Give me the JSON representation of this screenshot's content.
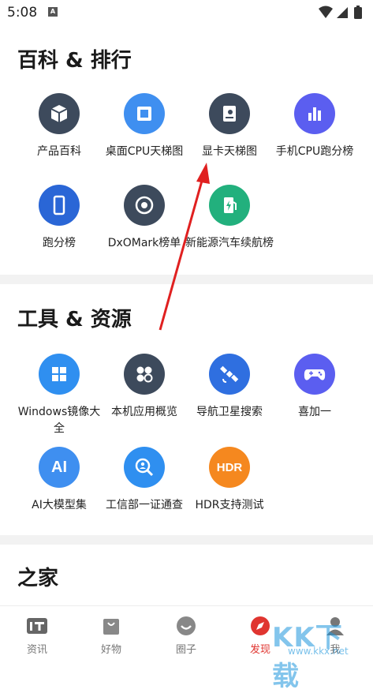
{
  "status_bar": {
    "time": "5:08",
    "notif_glyph": "A"
  },
  "sections": [
    {
      "title": "百科 & 排行",
      "items": [
        {
          "label": "产品百科",
          "icon": "cube-icon",
          "color": "#3d4a5c"
        },
        {
          "label": "桌面CPU天梯图",
          "icon": "cpu-chip-icon",
          "color": "#3f8ff0"
        },
        {
          "label": "显卡天梯图",
          "icon": "graphics-card-icon",
          "color": "#3d4a5c"
        },
        {
          "label": "手机CPU跑分榜",
          "icon": "bar-chart-icon",
          "color": "#5b5ef0"
        },
        {
          "label": "跑分榜",
          "icon": "phone-icon",
          "color": "#2a66d6"
        },
        {
          "label": "DxOMark榜单",
          "icon": "camera-lens-icon",
          "color": "#3d4a5c"
        },
        {
          "label": "新能源汽车续航榜",
          "icon": "charging-station-icon",
          "color": "#22b07d"
        }
      ]
    },
    {
      "title": "工具 & 资源",
      "items": [
        {
          "label": "Windows镜像大全",
          "icon": "windows-logo-icon",
          "color": "#2f8ff0"
        },
        {
          "label": "本机应用概览",
          "icon": "apps-grid-icon",
          "color": "#3d4a5c"
        },
        {
          "label": "导航卫星搜索",
          "icon": "satellite-icon",
          "color": "#2f6fe0"
        },
        {
          "label": "喜加一",
          "icon": "gamepad-icon",
          "color": "#5b5ef0"
        },
        {
          "label": "AI大模型集",
          "icon": "ai-text-icon",
          "color": "#3f8ff0",
          "badge": "AI"
        },
        {
          "label": "工信部一证通查",
          "icon": "search-person-icon",
          "color": "#2f8ff0"
        },
        {
          "label": "HDR支持测试",
          "icon": "hdr-text-icon",
          "color": "#f5881f",
          "badge": "HDR"
        }
      ]
    },
    {
      "title": "之家"
    }
  ],
  "bottom_nav": [
    {
      "label": "资讯",
      "icon": "it-logo-icon",
      "active": false
    },
    {
      "label": "好物",
      "icon": "shopping-bag-icon",
      "active": false
    },
    {
      "label": "圈子",
      "icon": "chat-smile-icon",
      "active": false
    },
    {
      "label": "发现",
      "icon": "compass-icon",
      "active": true
    },
    {
      "label": "我",
      "icon": "profile-icon",
      "active": false
    }
  ],
  "watermark": {
    "main": "KK下载",
    "url": "www.kkx.net"
  },
  "colors": {
    "accent": "#e03530",
    "divider": "#f2f2f2",
    "arrow": "#e02020"
  }
}
